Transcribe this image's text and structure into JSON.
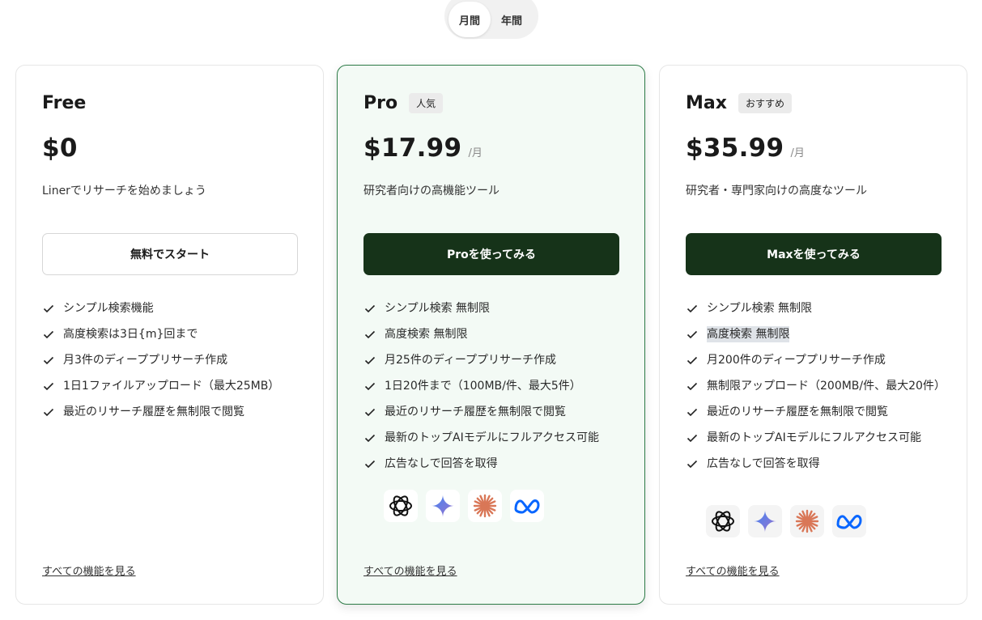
{
  "toggle": {
    "monthly": "月間",
    "yearly": "年間"
  },
  "plans": [
    {
      "name": "Free",
      "badge": "",
      "price": "$0",
      "unit": "",
      "desc": "Linerでリサーチを始めましょう",
      "cta": "無料でスタート",
      "features": [
        "シンプル検索機能",
        "高度検索は3日{m}回まで",
        "月3件のディーププリサーチ作成",
        "1日1ファイルアップロード（最大25MB）",
        "最近のリサーチ履歴を無制限で閲覧"
      ],
      "see_all": "すべての機能を見る"
    },
    {
      "name": "Pro",
      "badge": "人気",
      "price": "$17.99",
      "unit": "/月",
      "desc": "研究者向けの高機能ツール",
      "cta": "Proを使ってみる",
      "features": [
        "シンプル検索 無制限",
        "高度検索 無制限",
        "月25件のディーププリサーチ作成",
        "1日20件まで（100MB/件、最大5件）",
        "最近のリサーチ履歴を無制限で閲覧",
        "最新のトップAIモデルにフルアクセス可能",
        "広告なしで回答を取得"
      ],
      "see_all": "すべての機能を見る"
    },
    {
      "name": "Max",
      "badge": "おすすめ",
      "price": "$35.99",
      "unit": "/月",
      "desc": "研究者・専門家向けの高度なツール",
      "cta": "Maxを使ってみる",
      "features": [
        "シンプル検索 無制限",
        "高度検索 無制限",
        "月200件のディーププリサーチ作成",
        "無制限アップロード（200MB/件、最大20件）",
        "最近のリサーチ履歴を無制限で閲覧",
        "最新のトップAIモデルにフルアクセス可能",
        "広告なしで回答を取得"
      ],
      "see_all": "すべての機能を見る"
    }
  ],
  "model_icons": [
    "openai-icon",
    "gemini-icon",
    "claude-icon",
    "meta-icon"
  ],
  "colors": {
    "accent_dark": "#163319",
    "pro_border": "#2c7a46",
    "pro_bg": "#f3faf5",
    "claude": "#d97757",
    "meta": "#0866ff"
  }
}
